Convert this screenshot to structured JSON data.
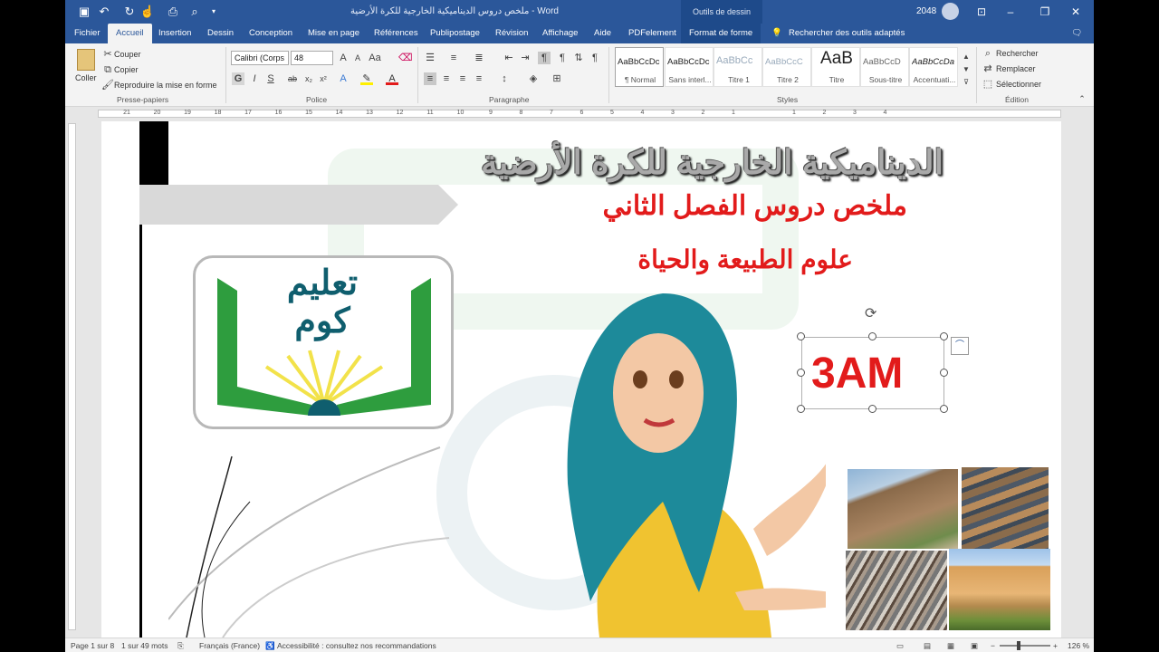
{
  "titlebar": {
    "doc_title": "ملخص دروس الديناميكية الخارجية للكرة الأرضية  -  Word",
    "context_tools": "Outils de dessin",
    "user_id": "2048",
    "quick_access": [
      "save-icon",
      "undo-icon",
      "redo-icon",
      "touch-mode-icon",
      "print-preview-icon",
      "customize-icon"
    ]
  },
  "tabs": {
    "fichier": "Fichier",
    "accueil": "Accueil",
    "insertion": "Insertion",
    "dessin": "Dessin",
    "conception": "Conception",
    "mise_en_page": "Mise en page",
    "references": "Références",
    "publipostage": "Publipostage",
    "revision": "Révision",
    "affichage": "Affichage",
    "aide": "Aide",
    "pdfelement": "PDFelement",
    "format_forme": "Format de forme",
    "search": "Rechercher des outils adaptés"
  },
  "ribbon": {
    "clipboard": {
      "paste": "Coller",
      "cut": "Couper",
      "copy": "Copier",
      "format_painter": "Reproduire la mise en forme",
      "label": "Presse-papiers"
    },
    "font": {
      "name": "Calibri (Corps",
      "size": "48",
      "label": "Police"
    },
    "paragraph": {
      "label": "Paragraphe"
    },
    "styles": {
      "label": "Styles",
      "items": [
        {
          "preview": "AaBbCcDc",
          "name": "¶ Normal"
        },
        {
          "preview": "AaBbCcDc",
          "name": "Sans interl..."
        },
        {
          "preview": "AaBbCc",
          "name": "Titre 1"
        },
        {
          "preview": "AaBbCcC",
          "name": "Titre 2"
        },
        {
          "preview": "AaB",
          "name": "Titre"
        },
        {
          "preview": "AaBbCcD",
          "name": "Sous-titre"
        },
        {
          "preview": "AaBbCcDa",
          "name": "Accentuati..."
        }
      ]
    },
    "editing": {
      "find": "Rechercher",
      "replace": "Remplacer",
      "select": "Sélectionner",
      "label": "Édition"
    }
  },
  "ruler": {
    "numbers": [
      "21",
      "20",
      "19",
      "18",
      "17",
      "16",
      "15",
      "14",
      "13",
      "12",
      "11",
      "10",
      "9",
      "8",
      "7",
      "6",
      "5",
      "4",
      "3",
      "2",
      "1",
      "",
      "1",
      "2",
      "3",
      "4"
    ]
  },
  "document": {
    "title": "الديناميكية الخارجية للكرة الأرضية",
    "subtitle": "ملخص دروس الفصل الثاني",
    "subject": "علوم الطبيعة والحياة",
    "logo_text_1": "تعليم",
    "logo_text_2": "كوم",
    "level": "3AM"
  },
  "statusbar": {
    "page": "Page 1 sur 8",
    "words": "1 sur 49 mots",
    "language": "Français (France)",
    "accessibility": "Accessibilité : consultez nos recommandations",
    "zoom": "126 %"
  },
  "colors": {
    "word_blue": "#2b579a",
    "title_gray": "#9a9a9a",
    "red_text": "#e21b1b",
    "logo_green": "#2e9d3e",
    "logo_teal": "#0f5e6e"
  }
}
